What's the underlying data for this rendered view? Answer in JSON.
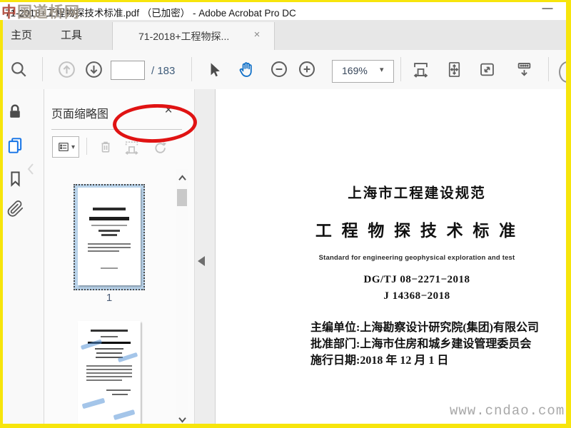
{
  "window": {
    "title": "71-2018+工程物探技术标准.pdf （已加密） - Adobe Acrobat Pro DC",
    "watermark_top_left": "中国道桥网",
    "watermark_accent_char": "中",
    "watermark_bottom_right": "www.cndao.com"
  },
  "glyphs": {
    "minimize": "—",
    "close": "×",
    "caret_down": "▾"
  },
  "tab_bar": {
    "home_label": "主页",
    "tools_label": "工具",
    "document_tab_label": "71-2018+工程物探..."
  },
  "toolbar": {
    "page_input_value": "",
    "page_total_label": "/ 183",
    "zoom_value": "169%",
    "annotation_color": "#e01313",
    "accent_color": "#1473e6"
  },
  "sidebar": {
    "panel_title": "页面缩略图",
    "thumbnails": [
      {
        "page_label": "1"
      },
      {
        "page_label": ""
      }
    ]
  },
  "document": {
    "heading": "上海市工程建设规范",
    "title": "工 程 物 探 技 术 标 准",
    "subtitle_en": "Standard for engineering geophysical exploration and test",
    "code_line1": "DG/TJ 08−2271−2018",
    "code_line2": "J 14368−2018",
    "chief_editor_line": "主编单位:上海勘察设计研究院(集团)有限公司",
    "approval_line": "批准部门:上海市住房和城乡建设管理委员会",
    "effective_date_line": "施行日期:2018 年 12 月 1 日"
  }
}
